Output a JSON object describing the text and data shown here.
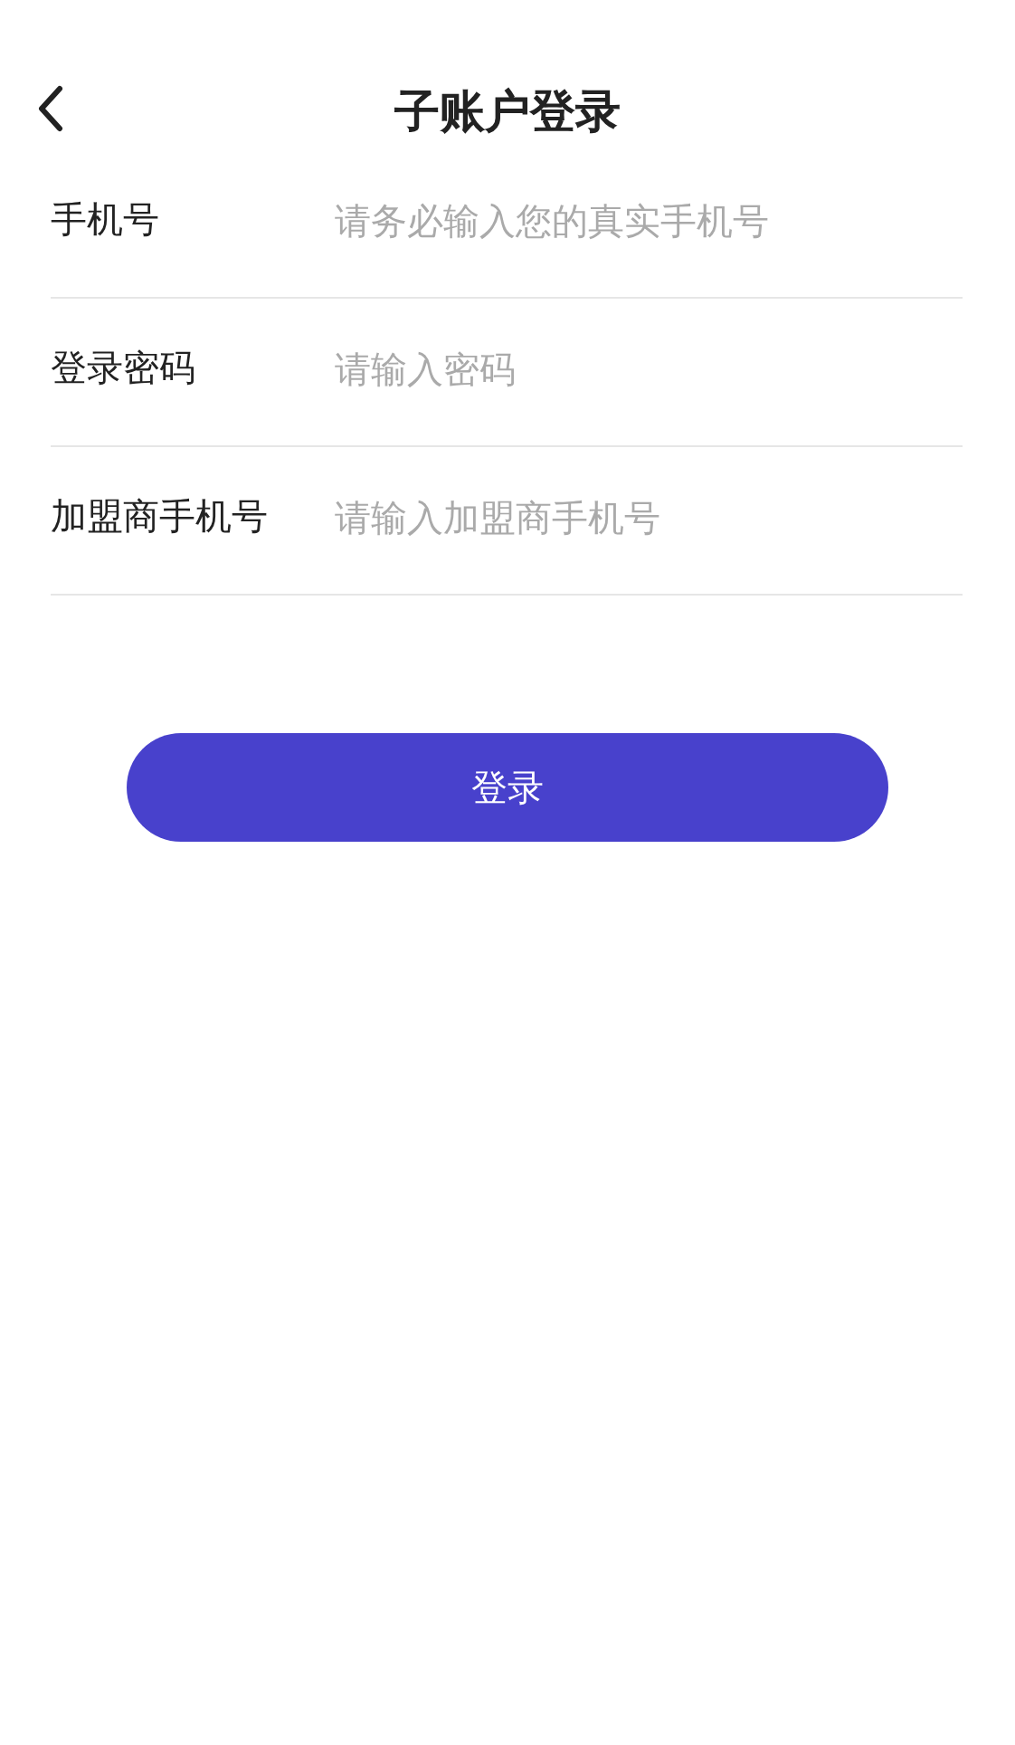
{
  "header": {
    "title": "子账户登录"
  },
  "fields": [
    {
      "label": "手机号",
      "placeholder": "请务必输入您的真实手机号"
    },
    {
      "label": "登录密码",
      "placeholder": "请输入密码"
    },
    {
      "label": "加盟商手机号",
      "placeholder": "请输入加盟商手机号"
    }
  ],
  "submit_button": "登录"
}
